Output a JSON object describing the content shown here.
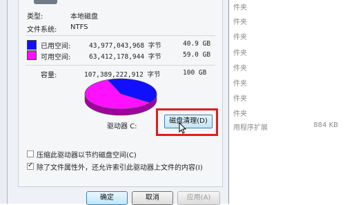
{
  "properties": {
    "type_label": "类型:",
    "type_value": "本地磁盘",
    "fs_label": "文件系统:",
    "fs_value": "NTFS",
    "used_label": "已用空间:",
    "used_bytes": "43,977,043,968 字节",
    "used_size": "40.9 GB",
    "free_label": "可用空间:",
    "free_bytes": "63,412,178,944 字节",
    "free_size": "59.0 GB",
    "capacity_label": "容量:",
    "capacity_bytes": "107,389,222,912 字节",
    "capacity_size": "100 GB",
    "drive_label": "驱动器 C:",
    "cleanup_button": "磁盘清理(D)",
    "compress_option": "压缩此驱动器以节约磁盘空间(C)",
    "compress_checked": false,
    "index_option": "除了文件属性外，还允许索引此驱动器上文件的内容(I)",
    "index_checked": true
  },
  "buttons": {
    "ok": "确定",
    "cancel": "取消",
    "apply": "应用(A)"
  },
  "colors": {
    "used": "#1010ff",
    "free": "#ff10ff",
    "highlight": "#e01b1b"
  },
  "background": {
    "rows": [
      "件夹",
      "件夹",
      "件夹",
      "件夹",
      "件夹",
      "件夹",
      "件夹",
      "件夹",
      "件夹",
      "件夹",
      "用程序扩展"
    ],
    "size": "884 KB"
  },
  "chart_data": {
    "type": "pie",
    "categories": [
      "已用空间",
      "可用空间"
    ],
    "values": [
      40.9,
      59.0
    ]
  }
}
